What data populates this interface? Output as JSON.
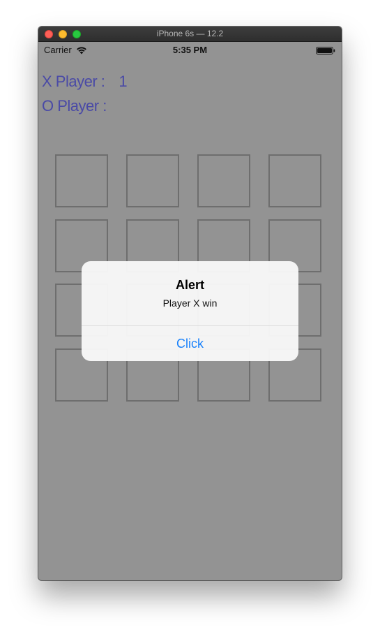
{
  "window": {
    "title": "iPhone 6s — 12.2"
  },
  "status_bar": {
    "carrier": "Carrier",
    "time": "5:35 PM"
  },
  "scores": {
    "x_label": "X Player :",
    "x_value": "1",
    "o_label": "O Player :",
    "o_value": ""
  },
  "board": {
    "rows": 4,
    "cols": 4,
    "cells": [
      "",
      "",
      "",
      "",
      "",
      "",
      "",
      "",
      "",
      "",
      "",
      "",
      "",
      "",
      "",
      ""
    ]
  },
  "alert": {
    "title": "Alert",
    "message": "Player X win",
    "button_label": "Click"
  },
  "colors": {
    "dim_background": "#939393",
    "score_text": "#4a4aa6",
    "cell_border": "#6e6e6e",
    "alert_button": "#1a82fb"
  },
  "icons": [
    "wifi-icon",
    "battery-icon"
  ]
}
